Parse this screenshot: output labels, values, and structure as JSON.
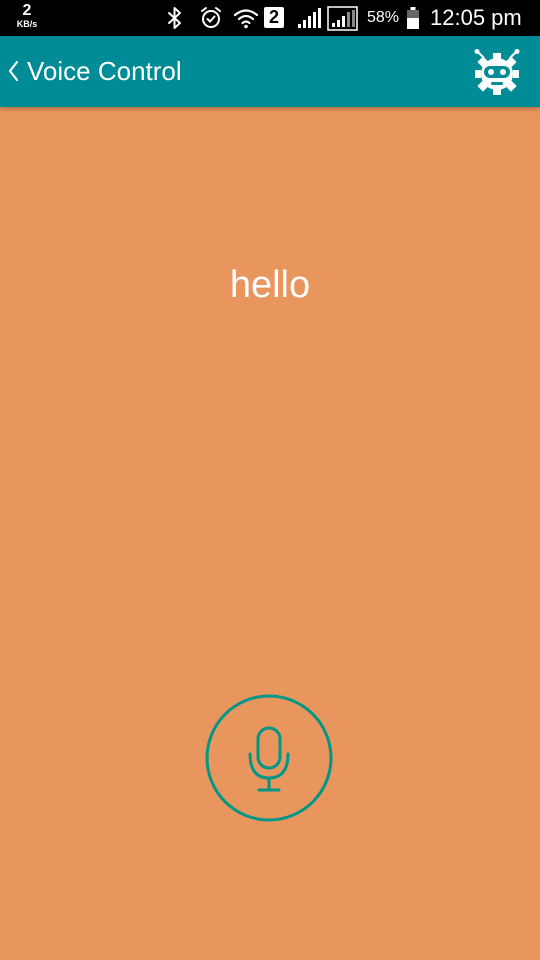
{
  "status_bar": {
    "net_speed_value": "2",
    "net_speed_unit": "KB/s",
    "sim_slot": "2",
    "battery": "58%",
    "time": "12:05 pm",
    "icons": [
      "bluetooth-icon",
      "alarm-icon",
      "wifi-icon",
      "sim-2-icon",
      "signal-icon",
      "signal-icon",
      "battery-icon"
    ]
  },
  "app_bar": {
    "title": "Voice Control",
    "back_icon": "chevron-left-icon",
    "action_icon": "robot-gear-icon",
    "color": "#008C96"
  },
  "main": {
    "recognized_text": "hello",
    "background_color": "#E9955E",
    "mic_icon": "microphone-icon",
    "accent_color": "#009688"
  }
}
